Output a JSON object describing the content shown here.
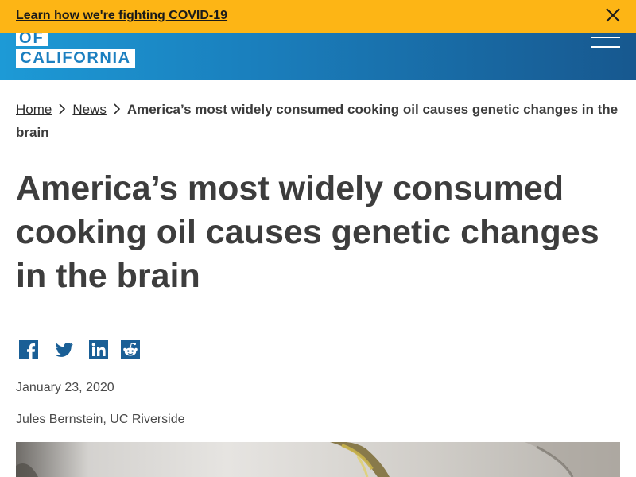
{
  "alert": {
    "link_text": "Learn how we're fighting COVID-19",
    "close_icon": "close-icon"
  },
  "header": {
    "logo_of": "OF",
    "logo_california": "CALIFORNIA",
    "menu_icon": "hamburger-menu-icon",
    "gradient_start": "#1d9ad6",
    "gradient_end": "#17588f"
  },
  "breadcrumb": {
    "home": "Home",
    "news": "News",
    "current": "America’s most widely consumed cooking oil causes genetic changes in the brain",
    "separator_icon": "chevron-right-icon"
  },
  "article": {
    "title": "America’s most widely consumed cooking oil causes genetic changes in the brain",
    "date": "January 23, 2020",
    "author": "Jules Bernstein, UC Riverside"
  },
  "share": {
    "icons": [
      "facebook-icon",
      "twitter-icon",
      "linkedin-icon",
      "reddit-icon"
    ],
    "icon_color": "#1a5f96"
  },
  "colors": {
    "alert_bg": "#fdb515",
    "text": "#3d3d3d"
  }
}
